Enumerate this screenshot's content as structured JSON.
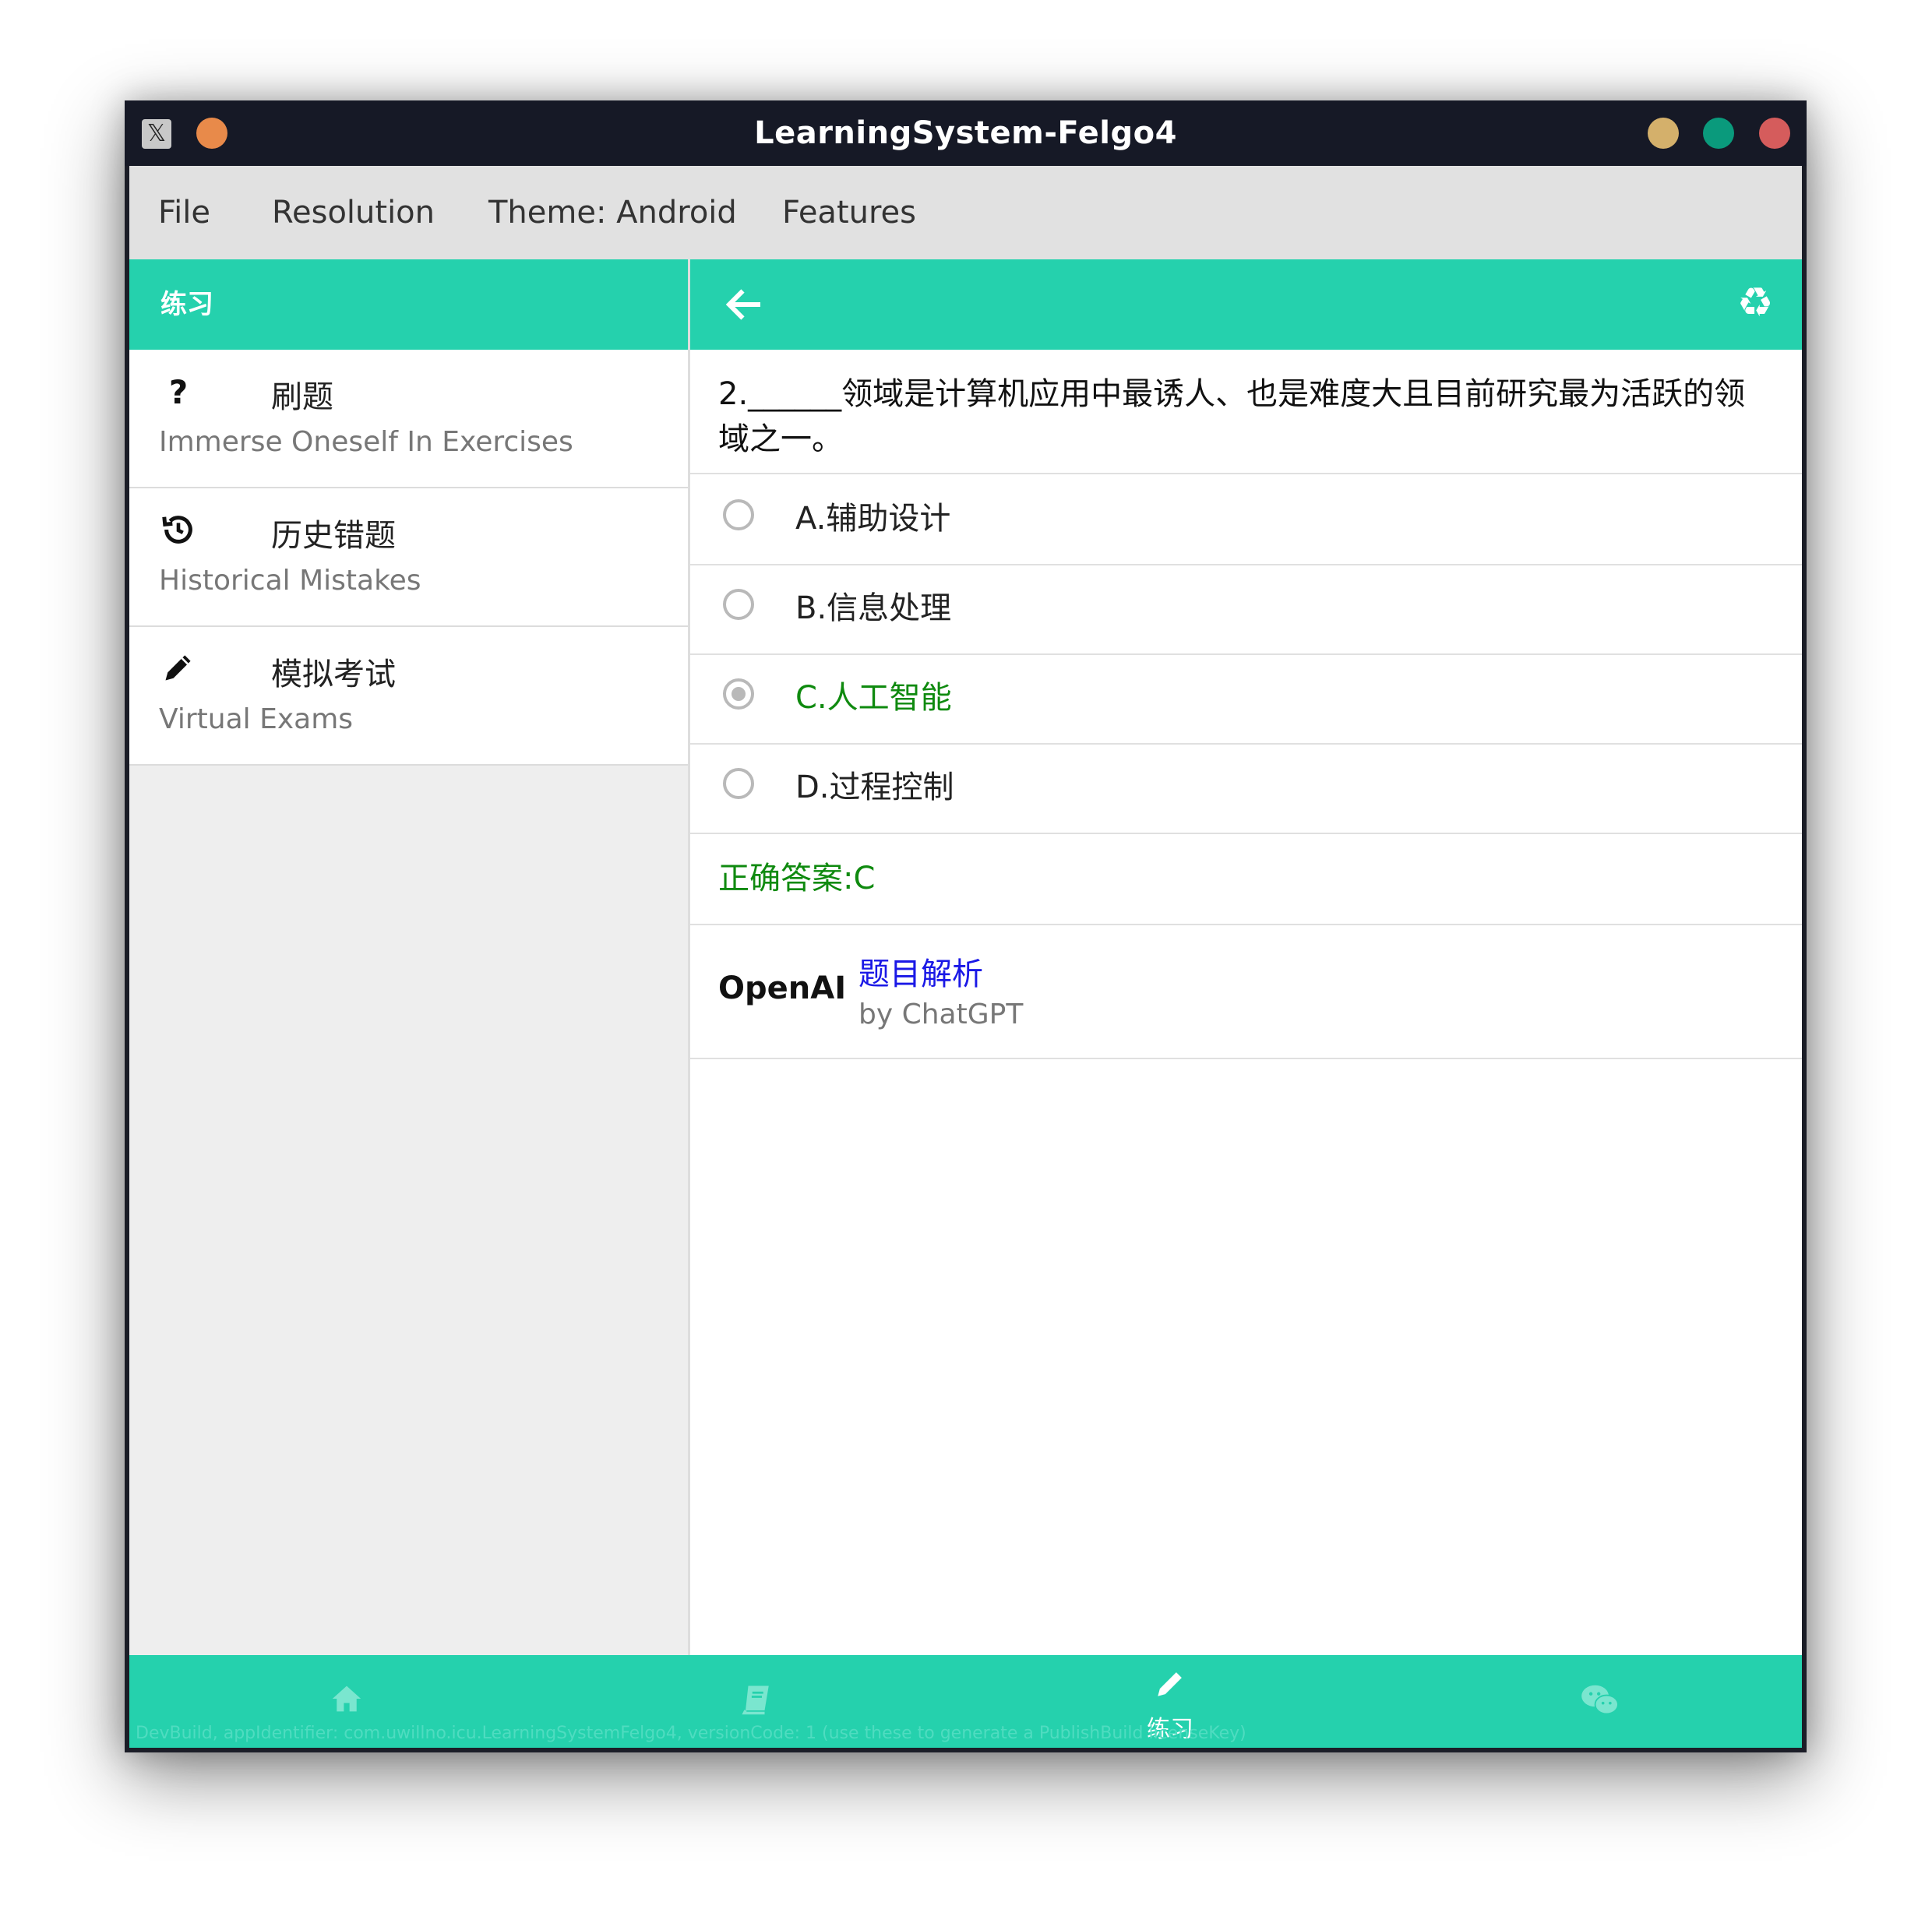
{
  "window": {
    "title": "LearningSystem-Felgo4",
    "dots": {
      "left": "#e88a4a",
      "yellow": "#d4b06b",
      "green": "#0a9a7c",
      "red": "#d55c5c"
    }
  },
  "menubar": {
    "items": [
      {
        "label": "File"
      },
      {
        "label": "Resolution"
      },
      {
        "label": "Theme: Android"
      },
      {
        "label": "Features"
      }
    ]
  },
  "sidebar": {
    "header": "练习",
    "items": [
      {
        "icon": "question-icon",
        "title": "刷题",
        "subtitle": "Immerse Oneself In Exercises"
      },
      {
        "icon": "history-icon",
        "title": "历史错题",
        "subtitle": "Historical Mistakes"
      },
      {
        "icon": "pencil-icon",
        "title": "模拟考试",
        "subtitle": "Virtual Exams"
      }
    ]
  },
  "main": {
    "question": "2.______领域是计算机应用中最诱人、也是难度大且目前研究最为活跃的领域之一。",
    "options": [
      {
        "label": "A.辅助设计",
        "selected": false
      },
      {
        "label": "B.信息处理",
        "selected": false
      },
      {
        "label": "C.人工智能",
        "selected": true
      },
      {
        "label": "D.过程控制",
        "selected": false
      }
    ],
    "answer": "正确答案:C",
    "openai": {
      "brand": "OpenAI",
      "link": "题目解析",
      "by": "by ChatGPT"
    }
  },
  "bottom_nav": {
    "tabs": [
      {
        "icon": "home-icon"
      },
      {
        "icon": "book-icon"
      },
      {
        "icon": "pencil-icon",
        "label": "练习",
        "active": true
      },
      {
        "icon": "wechat-icon"
      }
    ],
    "dev_banner": "DevBuild, appIdentifier: com.uwillno.icu.LearningSystemFelgo4, versionCode: 1 (use these to generate a PublishBuild licenseKey)"
  },
  "colors": {
    "accent": "#25d1ad",
    "correct": "#0f8a0f",
    "link": "#1a18e6"
  }
}
